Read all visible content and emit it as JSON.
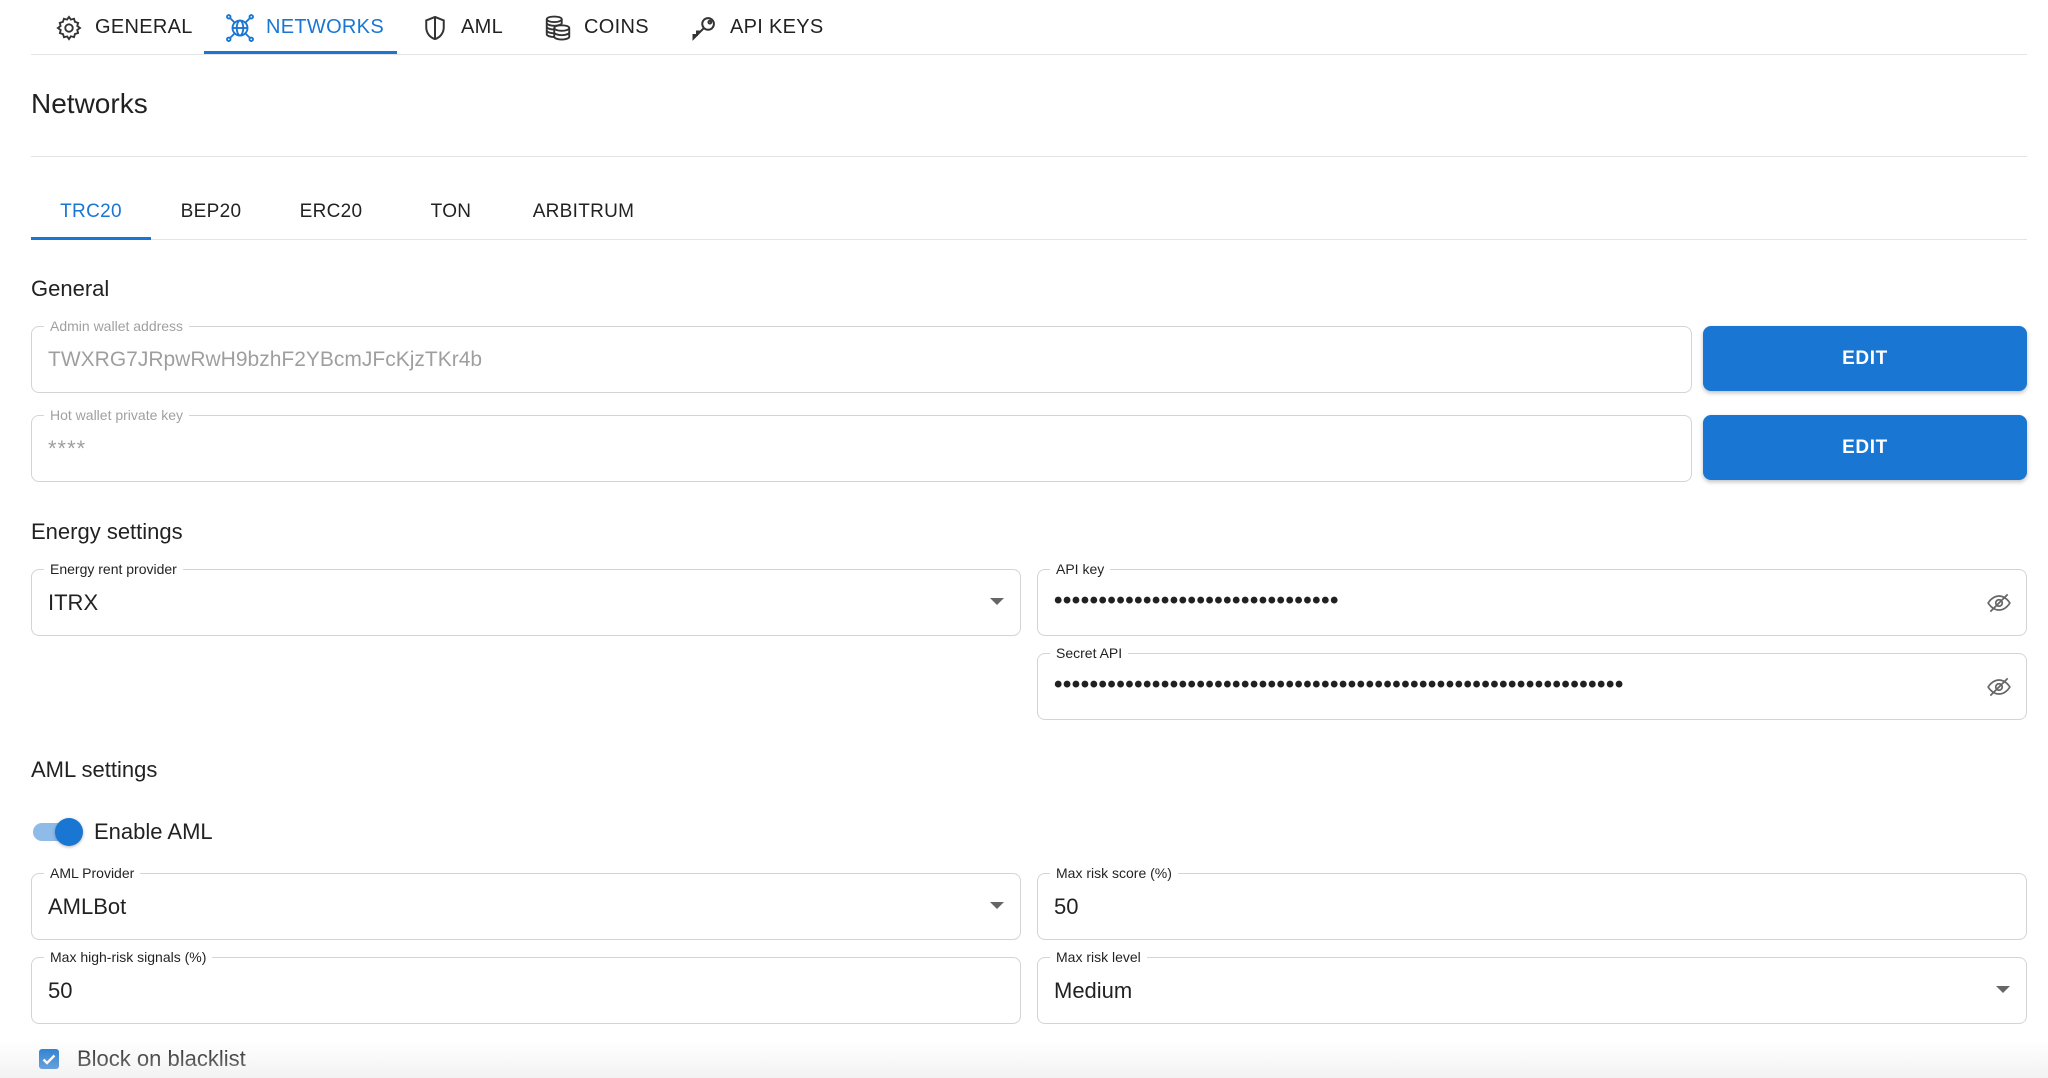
{
  "topnav": {
    "tabs": [
      {
        "label": "GENERAL",
        "icon": "gear-icon"
      },
      {
        "label": "NETWORKS",
        "icon": "network-globe-icon",
        "active": true
      },
      {
        "label": "AML",
        "icon": "shield-icon"
      },
      {
        "label": "COINS",
        "icon": "coins-stack-icon"
      },
      {
        "label": "API KEYS",
        "icon": "key-icon"
      }
    ]
  },
  "page": {
    "title": "Networks"
  },
  "network_tabs": {
    "items": [
      "TRC20",
      "BEP20",
      "ERC20",
      "TON",
      "ARBITRUM"
    ],
    "selected": "TRC20"
  },
  "general": {
    "title": "General",
    "admin_wallet": {
      "label": "Admin wallet address",
      "value": "TWXRG7JRpwRwH9bzhF2YBcmJFcKjzTKr4b",
      "button": "EDIT"
    },
    "hot_wallet": {
      "label": "Hot wallet private key",
      "value": "****",
      "button": "EDIT"
    }
  },
  "energy": {
    "title": "Energy settings",
    "provider": {
      "label": "Energy rent provider",
      "value": "ITRX"
    },
    "api_key": {
      "label": "API key",
      "value": "••••••••••••••••••••••••••••••••"
    },
    "secret_api": {
      "label": "Secret API",
      "value": "••••••••••••••••••••••••••••••••••••••••••••••••••••••••••••••••"
    }
  },
  "aml": {
    "title": "AML settings",
    "enable": {
      "label": "Enable AML",
      "checked": true
    },
    "provider": {
      "label": "AML Provider",
      "value": "AMLBot"
    },
    "max_risk_score": {
      "label": "Max risk score (%)",
      "value": "50"
    },
    "max_high_risk_signals": {
      "label": "Max high-risk signals (%)",
      "value": "50"
    },
    "max_risk_level": {
      "label": "Max risk level",
      "value": "Medium"
    },
    "block_blacklist": {
      "label": "Block on blacklist",
      "checked": true
    }
  },
  "colors": {
    "accent": "#1976d2",
    "divider": "#e4e4e4"
  }
}
